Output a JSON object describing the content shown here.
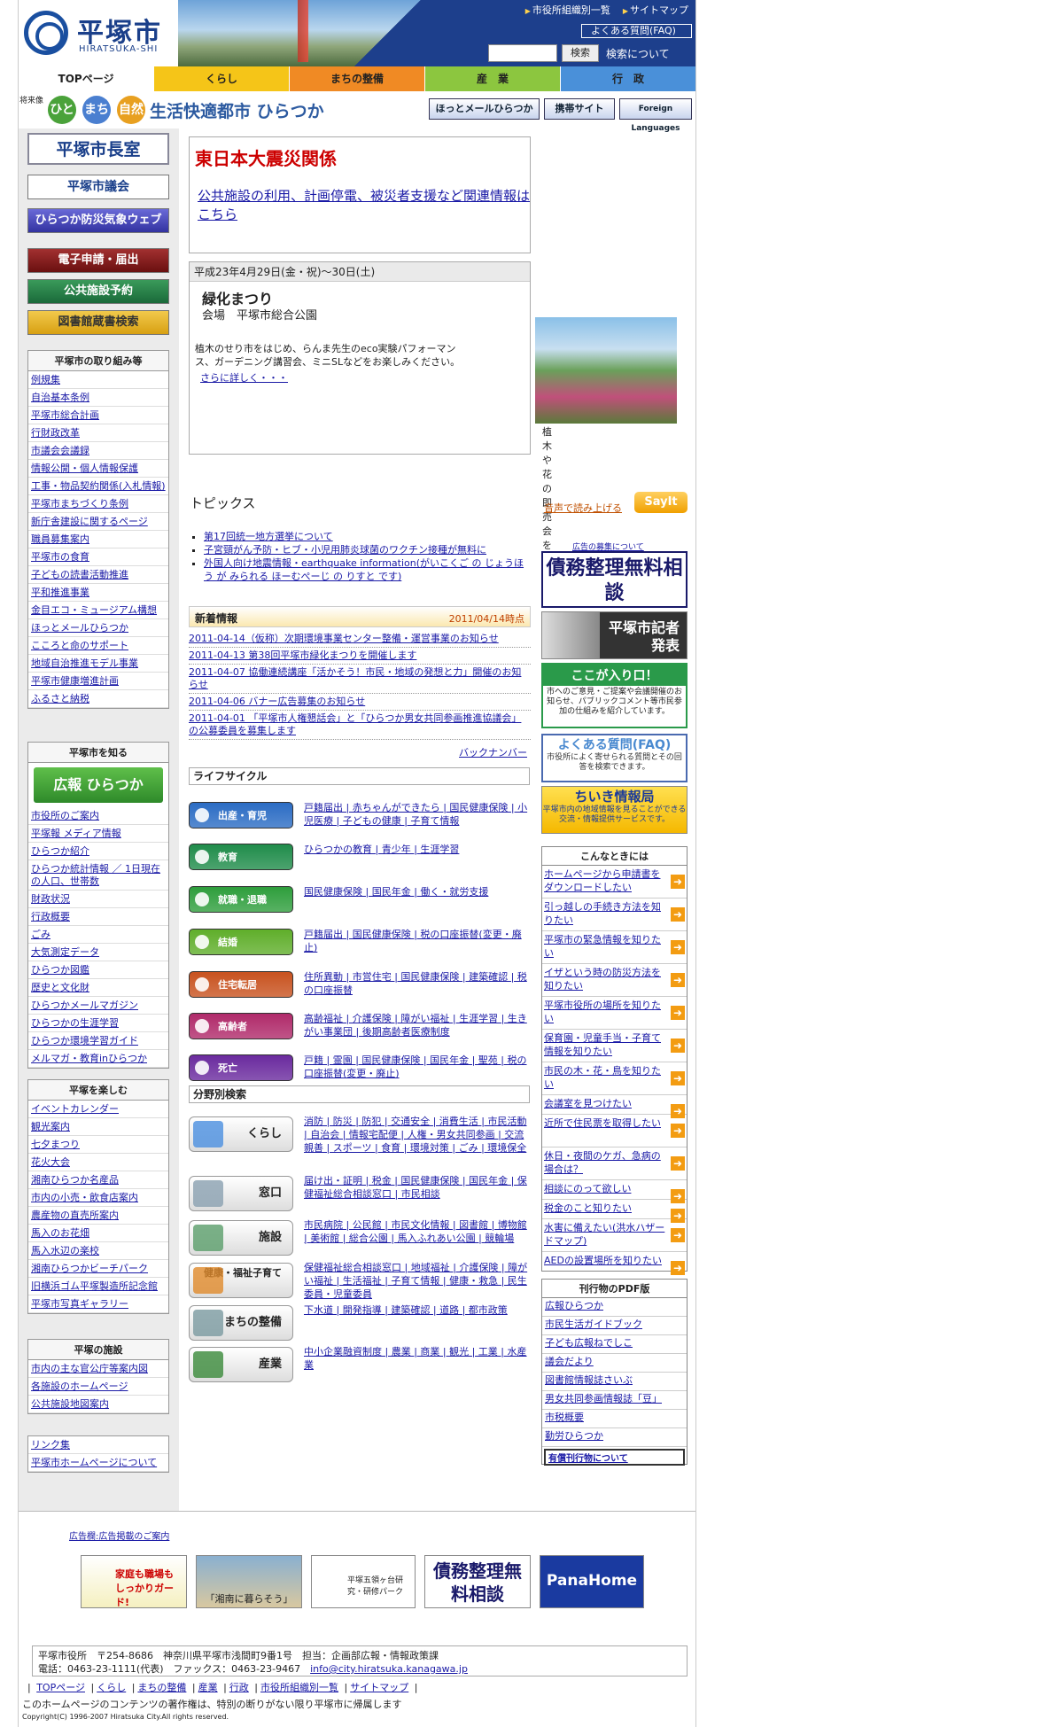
{
  "header": {
    "logo_jp": "平塚市",
    "logo_en": "HIRATSUKA-SHI",
    "links": [
      "市役所組織別一覧",
      "サイトマップ"
    ],
    "faq": "よくある質問(FAQ)",
    "search_button": "検索",
    "search_about": "検索について"
  },
  "gnav": [
    "TOPページ",
    "くらし",
    "まちの整備",
    "産　業",
    "行　政"
  ],
  "gnav_colors": [
    "#ffffff",
    "#f5c518",
    "#f08a24",
    "#8cc63f",
    "#4a90d9"
  ],
  "tagline": {
    "small": "将来像",
    "circles": [
      "ひと",
      "まち",
      "自然"
    ],
    "slogan": "生活快適都市 ひらつか",
    "buttons": [
      "ほっとメールひらつか",
      "携帯サイト",
      "Foreign Languages"
    ]
  },
  "left": {
    "mayor": "平塚市長室",
    "council": "平塚市議会",
    "bousai": "ひらつか防災気象ウェブ",
    "btn_e": "電子申請・届出",
    "btn_facility": "公共施設予約",
    "btn_library": "図書館蔵書検索",
    "s1_title": "平塚市の取り組み等",
    "s1": [
      "例規集",
      "自治基本条例",
      "平塚市総合計画",
      "行財政改革",
      "市議会会議録",
      "情報公開・個人情報保護",
      "工事・物品契約関係(入札情報)",
      "平塚市まちづくり条例",
      "新庁舎建設に関するページ",
      "職員募集案内",
      "平塚市の食育",
      "子どもの読書活動推進",
      "平和推進事業",
      "金目エコ・ミュージアム構想",
      "ほっとメールひらつか",
      "こころと命のサポート",
      "地域自治推進モデル事業",
      "平塚市健康増進計画",
      "ふるさと納税"
    ],
    "s2_title": "平塚市を知る",
    "koho": "広報 ひらつか",
    "s2": [
      "市役所のご案内",
      "平塚報 メディア情報",
      "ひらつか紹介",
      "ひらつか統計情報 ／ 1日現在の人口、世帯数",
      "財政状況",
      "行政概要",
      "ごみ",
      "大気測定データ",
      "ひらつか図鑑",
      "歴史と文化財",
      "ひらつかメールマガジン",
      "ひらつかの生涯学習",
      "ひらつか環境学習ガイド",
      "メルマガ・教育inひらつか"
    ],
    "s3_title": "平塚を楽しむ",
    "s3": [
      "イベントカレンダー",
      "観光案内",
      "七夕まつり",
      "花火大会",
      "湘南ひらつか名産品",
      "市内の小売・飲食店案内",
      "農産物の直売所案内",
      "馬入のお花畑",
      "馬入水辺の楽校",
      "湘南ひらつかビーチパーク",
      "旧横浜ゴム平塚製造所記念館",
      "平塚市写真ギャラリー"
    ],
    "s4_title": "平塚の施設",
    "s4": [
      "市内の主な官公庁等案内図",
      "各施設のホームページ",
      "公共施設地図案内"
    ],
    "s5": [
      "リンク集",
      "平塚市ホームページについて"
    ]
  },
  "center": {
    "quake_title": "東日本大震災関係",
    "quake_link": "公共施設の利用、計画停電、被災者支援など関連情報はこちら",
    "event_date": "平成23年4月29日(金・祝)～30日(土)",
    "event_title": "緑化まつり",
    "event_place": "会場　平塚市総合公園",
    "event_desc": "植木のせり市をはじめ、らんま先生のeco実験パフォーマンス、ガーデニング講習会、ミニSLなどをお楽しみください。",
    "event_more": "さらに詳しく・・・",
    "event_caption": "植木や花の即売会を開催",
    "topics_title": "トピックス",
    "sayit": "音声で読み上げる",
    "sayit_btn": "SayIt",
    "topics": [
      "第17回統一地方選挙について",
      "子宮頸がん予防・ヒブ・小児用肺炎球菌のワクチン接種が無料に",
      "外国人向け地震情報・earthquake information(がいこくご の じょうほう が みられる ほーむぺーじ の りすと です)"
    ],
    "news_title": "新着情報",
    "news_date": "2011/04/14時点",
    "news": [
      "2011-04-14（仮称）次期環境事業センター整備・運営事業のお知らせ",
      "2011-04-13 第38回平塚市緑化まつりを開催します",
      "2011-04-07 協働連続講座「活かそう！市民・地域の発想と力」開催のお知らせ",
      "2011-04-06 バナー広告募集のお知らせ",
      "2011-04-01 「平塚市人権懇話会」と「ひらつか男女共同参画推進協議会」の公募委員を募集します"
    ],
    "backnumber": "バックナンバー",
    "life_title": "ライフサイクル",
    "life": [
      {
        "label": "出産・育児",
        "color": "#2b6cc4",
        "links": "戸籍届出 | 赤ちゃんができたら | 国民健康保険 | 小児医療 | 子どもの健康 | 子育て情報"
      },
      {
        "label": "教育",
        "color": "#1f8c4a",
        "links": "ひらつかの教育 | 青少年 | 生涯学習"
      },
      {
        "label": "就職・退職",
        "color": "#2e9e3c",
        "links": "国民健康保険 | 国民年金 | 働く・就労支援"
      },
      {
        "label": "結婚",
        "color": "#5fae2a",
        "links": "戸籍届出 | 国民健康保険 | 税の口座振替(変更・廃止)"
      },
      {
        "label": "住宅転居",
        "color": "#c8521f",
        "links": "住所異動 | 市営住宅 | 国民健康保険 | 建築確認 | 税の口座振替"
      },
      {
        "label": "高齢者",
        "color": "#b02a6a",
        "links": "高齢福祉 | 介護保険 | 障がい福祉 | 生涯学習 | 生きがい事業団 | 後期高齢者医療制度"
      },
      {
        "label": "死亡",
        "color": "#6a2a9e",
        "links": "戸籍 | 霊園 | 国民健康保険 | 国民年金 | 聖苑 | 税の口座振替(変更・廃止)"
      }
    ],
    "field_title": "分野別検索",
    "fields": [
      {
        "label": "くらし",
        "color": "#4a8ee0",
        "links": "消防 | 防災 | 防犯 | 交通安全 | 消費生活 | 市民活動 | 自治会 | 情報宅配便 | 人権・男女共同参画 | 交流親善 | スポーツ | 食育 | 環境対策 | ごみ | 環境保全"
      },
      {
        "label": "窓口",
        "color": "#8aa0b0",
        "links": "届け出・証明 | 税金 | 国民健康保険 | 国民年金 | 保健福祉総合相談窓口 | 市民相談"
      },
      {
        "label": "施設",
        "color": "#5a9e6a",
        "links": "市民病院 | 公民館 | 市民文化情報 | 図書館 | 博物館 | 美術館 | 総合公園 | 馬入ふれあい公園 | 競輪場"
      },
      {
        "label": "健康・福祉子育て",
        "color": "#e08a2a",
        "links": "保健福祉総合相談窓口 | 地域福祉 | 介護保険 | 障がい福祉 | 生活福祉 | 子育て情報 | 健康・救急 | 民生委員・児童委員"
      },
      {
        "label": "まちの整備",
        "color": "#7a9aa0",
        "links": "下水道 | 開発指導 | 建築確認 | 道路 | 都市政策"
      },
      {
        "label": "産業",
        "color": "#3a8a3a",
        "links": "中小企業融資制度 | 農業 | 商業 | 観光 | 工業 | 水産業"
      }
    ]
  },
  "right": {
    "ad_note": "広告の募集について",
    "ad1": "債務整理無料相談",
    "kisha": "平塚市記者発表",
    "koko": "ここが入り口！",
    "koko_sub": "市へのご意見・ご提案や会議開催のお知らせ、パブリックコメント等市民参加の仕組みを紹介しています。",
    "faq": "よくある質問(FAQ)",
    "faq_sub": "市役所によく寄せられる質問とその回答を検索できます。",
    "chiiki": "ちいき情報局",
    "chiiki_sub": "平塚市内の地域情報を見ることができる交流・情報提供サービスです。",
    "konna_title": "こんなときには",
    "konna": [
      "ホームページから申請書をダウンロードしたい",
      "引っ越しの手続き方法を知りたい",
      "平塚市の緊急情報を知りたい",
      "イザという時の防災方法を知りたい",
      "平塚市役所の場所を知りたい",
      "保育園・児童手当・子育て情報を知りたい",
      "市民の木・花・鳥を知りたい",
      "会議室を見つけたい",
      "近所で住民票を取得したい",
      "休日・夜間のケガ、急病の場合は？",
      "相談にのって欲しい",
      "税金のこと知りたい",
      "水害に備えたい(洪水ハザードマップ)",
      "AEDの設置場所を知りたい"
    ],
    "pdf_title": "刊行物のPDF版",
    "pdf": [
      "広報ひらつか",
      "市民生活ガイドブック",
      "子ども広報ねでしこ",
      "議会だより",
      "図書館情報誌さいぶ",
      "男女共同参画情報誌「豆」",
      "市税概要",
      "勤労ひらつか"
    ],
    "pdf_paid": "有償刊行物について"
  },
  "footer": {
    "ad_note": "広告欄:広告掲載のご案内",
    "ads": [
      "家庭も職場もしっかりガード!",
      "「湘南に暮らそう」",
      "平塚五領ヶ台研究・研修パーク",
      "債務整理無料相談",
      "PanaHome"
    ],
    "address": "平塚市役所　〒254-8686　神奈川県平塚市浅間町9番1号　担当：企画部広報・情報政策課",
    "tel": "電話：0463-23-1111(代表)　ファックス：0463-23-9467",
    "mail": "info@city.hiratsuka.kanagawa.jp",
    "nav": [
      "TOPページ",
      "くらし",
      "まちの整備",
      "産業",
      "行政",
      "市役所組織別一覧",
      "サイトマップ"
    ],
    "copyright_note": "このホームページのコンテンツの著作権は、特別の断りがない限り平塚市に帰属します",
    "copyright": "Copyright(C) 1996-2007 Hiratsuka City.All rights reserved."
  }
}
